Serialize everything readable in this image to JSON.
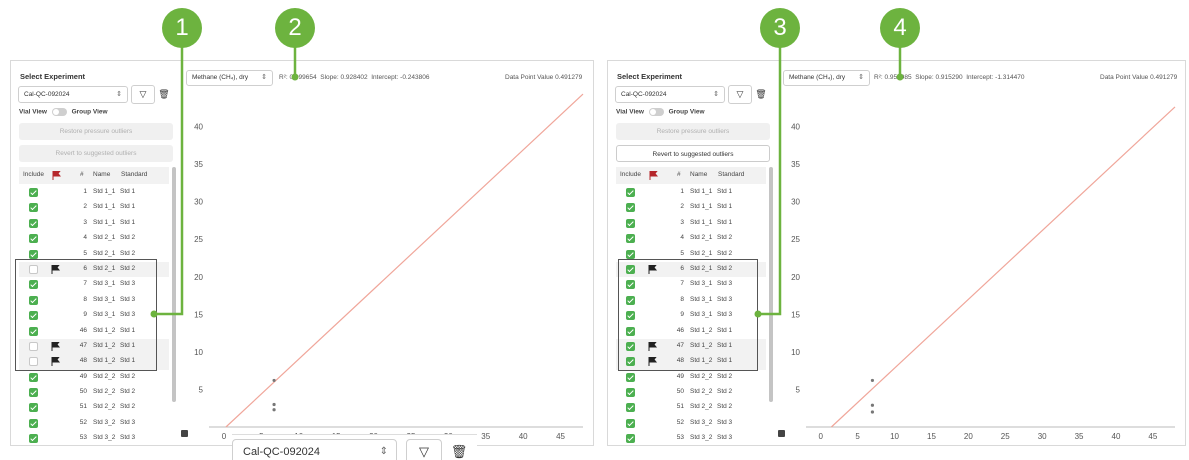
{
  "callouts": [
    "1",
    "2",
    "3",
    "4"
  ],
  "panels": [
    {
      "select_label": "Select Experiment",
      "experiment": "Cal-QC-092024",
      "vial_view": "Vial View",
      "group_view": "Group View",
      "restore_btn": "Restore pressure outliers",
      "revert_btn": "Revert to suggested outliers",
      "revert_enabled": false,
      "gas": "Methane (CH₄), dry",
      "r2_label": "R²:",
      "r2": "0.999654",
      "slope_label": "Slope:",
      "slope": "0.928402",
      "intercept_label": "Intercept:",
      "intercept": "-0.243806",
      "dpv_label": "Data Point Value",
      "dpv": "0.491279"
    },
    {
      "select_label": "Select Experiment",
      "experiment": "Cal-QC-092024",
      "vial_view": "Vial View",
      "group_view": "Group View",
      "restore_btn": "Restore pressure outliers",
      "revert_btn": "Revert to suggested outliers",
      "revert_enabled": true,
      "gas": "Methane (CH₄), dry",
      "r2_label": "R²:",
      "r2": "0.952085",
      "slope_label": "Slope:",
      "slope": "0.915290",
      "intercept_label": "Intercept:",
      "intercept": "-1.314470",
      "dpv_label": "Data Point Value",
      "dpv": "0.491279"
    }
  ],
  "table_headers": {
    "include": "Include",
    "flag": "flag-icon",
    "num": "#",
    "name": "Name",
    "standard": "Standard"
  },
  "rows_panel1": [
    {
      "include": true,
      "flag": false,
      "num": "1",
      "name": "Std 1_1",
      "std": "Std 1"
    },
    {
      "include": true,
      "flag": false,
      "num": "2",
      "name": "Std 1_1",
      "std": "Std 1"
    },
    {
      "include": true,
      "flag": false,
      "num": "3",
      "name": "Std 1_1",
      "std": "Std 1"
    },
    {
      "include": true,
      "flag": false,
      "num": "4",
      "name": "Std 2_1",
      "std": "Std 2"
    },
    {
      "include": true,
      "flag": false,
      "num": "5",
      "name": "Std 2_1",
      "std": "Std 2"
    },
    {
      "include": false,
      "flag": true,
      "num": "6",
      "name": "Std 2_1",
      "std": "Std 2"
    },
    {
      "include": true,
      "flag": false,
      "num": "7",
      "name": "Std 3_1",
      "std": "Std 3"
    },
    {
      "include": true,
      "flag": false,
      "num": "8",
      "name": "Std 3_1",
      "std": "Std 3"
    },
    {
      "include": true,
      "flag": false,
      "num": "9",
      "name": "Std 3_1",
      "std": "Std 3"
    },
    {
      "include": true,
      "flag": false,
      "num": "46",
      "name": "Std 1_2",
      "std": "Std 1"
    },
    {
      "include": false,
      "flag": true,
      "num": "47",
      "name": "Std 1_2",
      "std": "Std 1"
    },
    {
      "include": false,
      "flag": true,
      "num": "48",
      "name": "Std 1_2",
      "std": "Std 1"
    },
    {
      "include": true,
      "flag": false,
      "num": "49",
      "name": "Std 2_2",
      "std": "Std 2"
    },
    {
      "include": true,
      "flag": false,
      "num": "50",
      "name": "Std 2_2",
      "std": "Std 2"
    },
    {
      "include": true,
      "flag": false,
      "num": "51",
      "name": "Std 2_2",
      "std": "Std 2"
    },
    {
      "include": true,
      "flag": false,
      "num": "52",
      "name": "Std 3_2",
      "std": "Std 3"
    },
    {
      "include": true,
      "flag": false,
      "num": "53",
      "name": "Std 3_2",
      "std": "Std 3"
    }
  ],
  "rows_panel2": [
    {
      "include": true,
      "flag": false,
      "num": "1",
      "name": "Std 1_1",
      "std": "Std 1"
    },
    {
      "include": true,
      "flag": false,
      "num": "2",
      "name": "Std 1_1",
      "std": "Std 1"
    },
    {
      "include": true,
      "flag": false,
      "num": "3",
      "name": "Std 1_1",
      "std": "Std 1"
    },
    {
      "include": true,
      "flag": false,
      "num": "4",
      "name": "Std 2_1",
      "std": "Std 2"
    },
    {
      "include": true,
      "flag": false,
      "num": "5",
      "name": "Std 2_1",
      "std": "Std 2"
    },
    {
      "include": true,
      "flag": true,
      "num": "6",
      "name": "Std 2_1",
      "std": "Std 2"
    },
    {
      "include": true,
      "flag": false,
      "num": "7",
      "name": "Std 3_1",
      "std": "Std 3"
    },
    {
      "include": true,
      "flag": false,
      "num": "8",
      "name": "Std 3_1",
      "std": "Std 3"
    },
    {
      "include": true,
      "flag": false,
      "num": "9",
      "name": "Std 3_1",
      "std": "Std 3"
    },
    {
      "include": true,
      "flag": false,
      "num": "46",
      "name": "Std 1_2",
      "std": "Std 1"
    },
    {
      "include": true,
      "flag": true,
      "num": "47",
      "name": "Std 1_2",
      "std": "Std 1"
    },
    {
      "include": true,
      "flag": true,
      "num": "48",
      "name": "Std 1_2",
      "std": "Std 1"
    },
    {
      "include": true,
      "flag": false,
      "num": "49",
      "name": "Std 2_2",
      "std": "Std 2"
    },
    {
      "include": true,
      "flag": false,
      "num": "50",
      "name": "Std 2_2",
      "std": "Std 2"
    },
    {
      "include": true,
      "flag": false,
      "num": "51",
      "name": "Std 2_2",
      "std": "Std 2"
    },
    {
      "include": true,
      "flag": false,
      "num": "52",
      "name": "Std 3_2",
      "std": "Std 3"
    },
    {
      "include": true,
      "flag": false,
      "num": "53",
      "name": "Std 3_2",
      "std": "Std 3"
    }
  ],
  "zoom": {
    "experiment": "Cal-QC-092024"
  },
  "colors": {
    "accent": "#6db33f",
    "check": "#4caf50",
    "line": "#f0a69a",
    "flag_header": "#b5262b"
  },
  "chart_data": [
    {
      "type": "scatter",
      "x_ticks": [
        0,
        5,
        10,
        15,
        20,
        25,
        30,
        35,
        40,
        45
      ],
      "y_ticks": [
        5,
        10,
        15,
        20,
        25,
        30,
        35,
        40
      ],
      "xlim": [
        -2,
        48
      ],
      "ylim": [
        0,
        45
      ],
      "fit_line": {
        "slope": 0.928402,
        "intercept": -0.243806
      },
      "points": [
        {
          "x": 6.7,
          "y": 6.2
        },
        {
          "x": 6.7,
          "y": 3.0
        },
        {
          "x": 6.7,
          "y": 2.3
        }
      ]
    },
    {
      "type": "scatter",
      "x_ticks": [
        0,
        5,
        10,
        15,
        20,
        25,
        30,
        35,
        40,
        45
      ],
      "y_ticks": [
        5,
        10,
        15,
        20,
        25,
        30,
        35,
        40
      ],
      "xlim": [
        -2,
        48
      ],
      "ylim": [
        0,
        45
      ],
      "fit_line": {
        "slope": 0.91529,
        "intercept": -1.31447
      },
      "points": [
        {
          "x": 7.0,
          "y": 6.2
        },
        {
          "x": 7.0,
          "y": 2.9
        },
        {
          "x": 7.0,
          "y": 2.0
        }
      ]
    }
  ]
}
